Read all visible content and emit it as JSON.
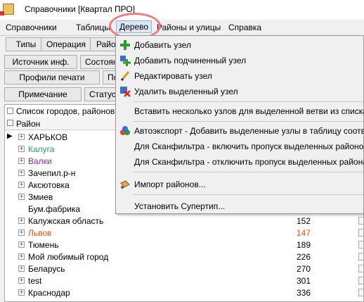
{
  "window": {
    "title": "Справочники [Квартал ПРО]"
  },
  "menubar": {
    "items": [
      "Справочники",
      "Таблицы",
      "Дерево",
      "Районы и улицы",
      "Справка"
    ]
  },
  "toolbar": {
    "row1": [
      "Типы",
      "Операция",
      "Район"
    ],
    "row2": [
      "Источник инф.",
      "Состоян"
    ],
    "row3": [
      "Профили печати",
      "По"
    ],
    "row4": [
      "Примечание",
      "Статус"
    ]
  },
  "grid": {
    "caption": "Список городов, районов, н",
    "header": "Район",
    "rows": [
      {
        "name": "ХАРЬКОВ",
        "code": "",
        "color": "#000000",
        "current": true,
        "expand": true
      },
      {
        "name": "Калуга",
        "code": "",
        "color": "#2e9a62",
        "current": false,
        "expand": true
      },
      {
        "name": "Валки",
        "code": "",
        "color": "#8e2aa8",
        "current": false,
        "expand": true
      },
      {
        "name": "Зачепил.р-н",
        "code": "",
        "color": "#000000",
        "current": false,
        "expand": true
      },
      {
        "name": "Аксютовка",
        "code": "",
        "color": "#000000",
        "current": false,
        "expand": true
      },
      {
        "name": "Змиев",
        "code": "",
        "color": "#000000",
        "current": false,
        "expand": true
      },
      {
        "name": "Бум.фабрика",
        "code": "",
        "color": "#000000",
        "current": false,
        "expand": false
      },
      {
        "name": "Калужская область",
        "code": "152",
        "color": "#000000",
        "current": false,
        "expand": true
      },
      {
        "name": "Львов",
        "code": "147",
        "color": "#e0561c",
        "current": false,
        "expand": true
      },
      {
        "name": "Тюмень",
        "code": "189",
        "color": "#000000",
        "current": false,
        "expand": true
      },
      {
        "name": "Мой любимый город",
        "code": "226",
        "color": "#000000",
        "current": false,
        "expand": true
      },
      {
        "name": "Беларусь",
        "code": "270",
        "color": "#000000",
        "current": false,
        "expand": true
      },
      {
        "name": "test",
        "code": "301",
        "color": "#000000",
        "current": false,
        "expand": true
      },
      {
        "name": "Краснодар",
        "code": "336",
        "color": "#000000",
        "current": false,
        "expand": true
      }
    ]
  },
  "dropdown": {
    "items": [
      {
        "label": "Добавить узел",
        "icon": "add-node-icon"
      },
      {
        "label": "Добавить подчиненный узел",
        "icon": "add-child-node-icon"
      },
      {
        "label": "Редактировать узел",
        "icon": "edit-pencil-icon"
      },
      {
        "label": "Удалить выделенный узел",
        "icon": "delete-node-icon"
      },
      {
        "label": "Вставить несколько узлов для выделенной ветви из списка...",
        "icon": ""
      },
      {
        "label": "Автоэкспорт - Добавить выделенные узлы в таблицу соотв",
        "icon": "autoexport-icon"
      },
      {
        "label": "Для Сканфильтра - включить пропуск выделенных районо",
        "icon": ""
      },
      {
        "label": "Для Сканфильтра - отключить пропуск выделенных района",
        "icon": ""
      },
      {
        "label": "Импорт районов...",
        "icon": "import-icon"
      },
      {
        "label": "Установить Супертип...",
        "icon": ""
      }
    ]
  },
  "colors": {
    "menu_highlight": "#dbe6f4",
    "ring": "#f07b7b"
  }
}
